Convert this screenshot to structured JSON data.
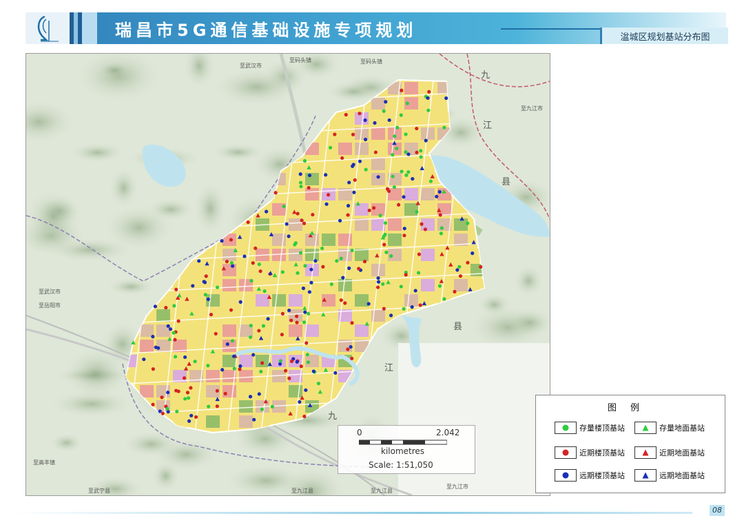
{
  "header": {
    "title": "瑞昌市5G通信基础设施专项规划",
    "subtitle": "湓城区规划基站分布图"
  },
  "map": {
    "place_labels": [
      {
        "text": "至武汉市"
      },
      {
        "text": "至码头镇"
      },
      {
        "text": "至码头镇"
      },
      {
        "text": "至九江市"
      },
      {
        "text": "至武汉市"
      },
      {
        "text": "至岳阳市"
      },
      {
        "text": "至高丰镇"
      },
      {
        "text": "至武宁县"
      },
      {
        "text": "至九江县"
      },
      {
        "text": "至九江县"
      },
      {
        "text": "至九江市"
      }
    ],
    "county_labels": [
      "九",
      "江",
      "县",
      "县",
      "江",
      "九"
    ],
    "colors": {
      "terrain": "#d9e3d2",
      "water": "#bfe3ee",
      "border": "#c05a6a",
      "residential": "#f3e27a",
      "commercial": "#ea9a9a",
      "industrial": "#d8b7a7",
      "green": "#8dbb68",
      "existing_site": "#2ecc40",
      "near_term_site": "#d42222",
      "long_term_site": "#1a2fb5"
    }
  },
  "scale": {
    "tick_min": "0",
    "tick_max": "2.042",
    "unit": "kilometres",
    "ratio": "Scale: 1:51,050"
  },
  "legend": {
    "title": "图例",
    "items": [
      {
        "label": "存量楼顶基站",
        "symbol": "circle",
        "color": "#2ecc40"
      },
      {
        "label": "存量地面基站",
        "symbol": "triangle",
        "color": "#2ecc40"
      },
      {
        "label": "近期楼顶基站",
        "symbol": "circle",
        "color": "#d42222"
      },
      {
        "label": "近期地面基站",
        "symbol": "triangle",
        "color": "#d42222"
      },
      {
        "label": "远期楼顶基站",
        "symbol": "circle",
        "color": "#1a2fb5"
      },
      {
        "label": "远期地面基站",
        "symbol": "triangle",
        "color": "#1a2fb5"
      }
    ]
  },
  "footer": {
    "page_number": "08"
  }
}
